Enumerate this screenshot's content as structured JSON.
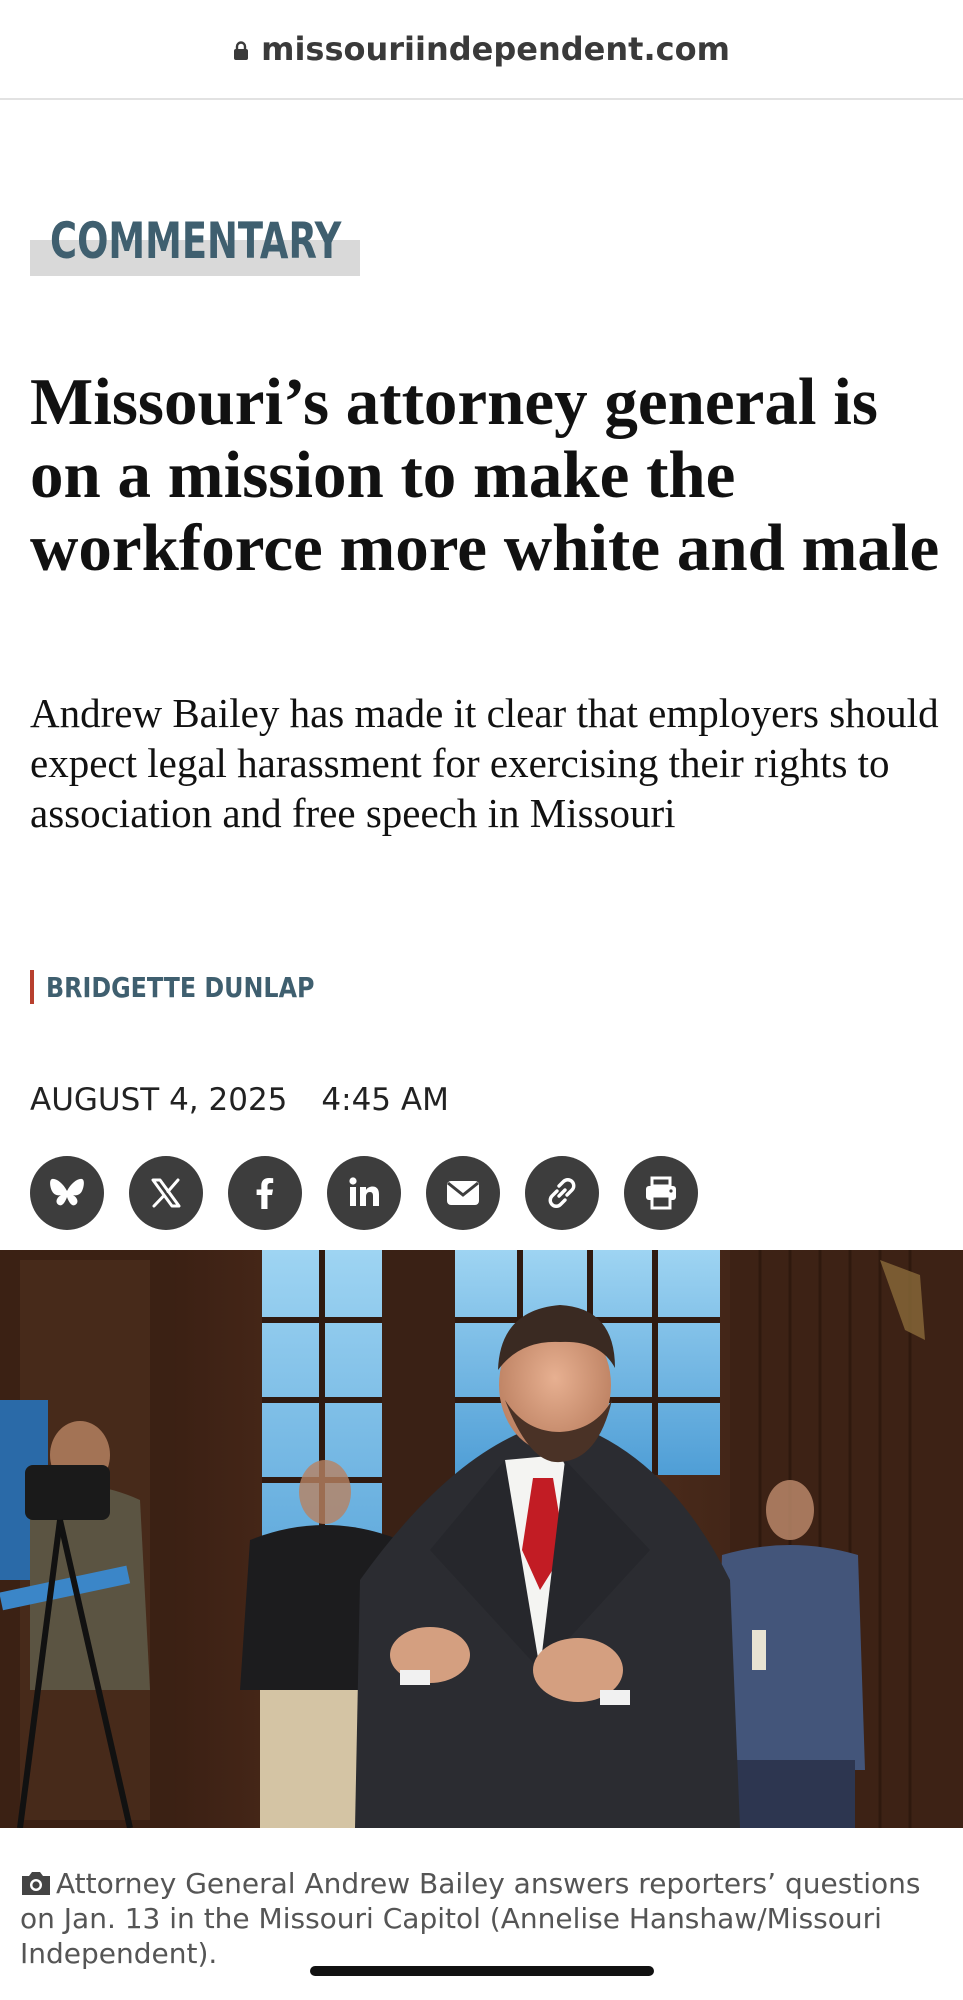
{
  "browser": {
    "url": "missouriindependent.com",
    "lock_icon": "lock-icon"
  },
  "article": {
    "section": "COMMENTARY",
    "headline": "Missouri’s attorney general is on a mission to make the workforce more white and male",
    "dek": "Andrew Bailey has made it clear that employers should expect legal harassment for exercising their rights to association and free speech in Missouri",
    "author": "BRIDGETTE DUNLAP",
    "date": "AUGUST 4, 2025",
    "time": "4:45 AM",
    "share_buttons": [
      {
        "name": "bluesky",
        "icon": "butterfly-icon"
      },
      {
        "name": "x",
        "icon": "x-logo-icon"
      },
      {
        "name": "facebook",
        "icon": "facebook-icon"
      },
      {
        "name": "linkedin",
        "icon": "linkedin-icon"
      },
      {
        "name": "email",
        "icon": "envelope-icon"
      },
      {
        "name": "copy-link",
        "icon": "link-icon"
      },
      {
        "name": "print",
        "icon": "printer-icon"
      }
    ],
    "photo_caption": "Attorney General Andrew Bailey answers reporters’ questions on Jan. 13 in the Missouri Capitol (Annelise Hanshaw/Missouri Independent).",
    "caption_icon": "camera-icon"
  },
  "colors": {
    "section_label": "#3f5f6f",
    "section_highlight": "#d9d9d9",
    "byline_accent": "#b8402e",
    "icon_circle": "#3d3d3d"
  }
}
